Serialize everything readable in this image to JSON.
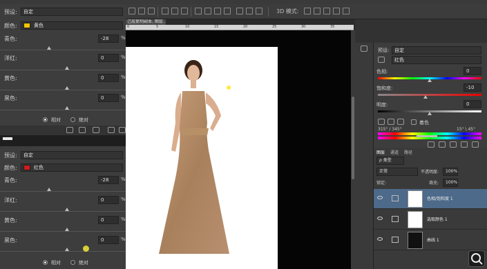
{
  "toolbar": {
    "mode_3d": "3D 模式:"
  },
  "document": {
    "tab_title": "己层复制副本, 图层...",
    "ruler_ticks": [
      "0",
      "5",
      "10",
      "15",
      "20",
      "25",
      "30",
      "35"
    ]
  },
  "dialog_top": {
    "preset_label": "预设:",
    "preset_value": "自定",
    "color_label": "颜色:",
    "color_value": "黄色",
    "color_swatch": "#f2c500",
    "sliders": [
      {
        "label": "青色:",
        "value": "-28",
        "unit": "%"
      },
      {
        "label": "洋红:",
        "value": "0",
        "unit": "%"
      },
      {
        "label": "黄色:",
        "value": "0",
        "unit": "%"
      },
      {
        "label": "黑色:",
        "value": "0",
        "unit": "%"
      }
    ],
    "radio_relative": "相对",
    "radio_absolute": "绝对"
  },
  "dialog_bottom": {
    "preset_label": "预设:",
    "preset_value": "自定",
    "color_label": "颜色:",
    "color_value": "红色",
    "color_swatch": "#d11a1a",
    "sliders": [
      {
        "label": "青色:",
        "value": "-28",
        "unit": "%"
      },
      {
        "label": "洋红:",
        "value": "0",
        "unit": "%"
      },
      {
        "label": "黄色:",
        "value": "0",
        "unit": "%"
      },
      {
        "label": "黑色:",
        "value": "0",
        "unit": "%"
      }
    ],
    "radio_relative": "相对",
    "radio_absolute": "绝对"
  },
  "properties": {
    "preset_label": "预设:",
    "preset_value": "自定",
    "channel_value": "红色",
    "hue_label": "色相:",
    "hue_value": "0",
    "saturation_label": "饱和度:",
    "saturation_value": "-10",
    "lightness_label": "明度:",
    "lightness_value": "0",
    "colorize_label": "着色",
    "range_left": "315° / 345°",
    "range_right": "15° \\ 45°"
  },
  "layers": {
    "tabs": [
      "图层",
      "通道",
      "路径"
    ],
    "filter_label": "ρ 类型",
    "blend_mode": "正常",
    "opacity_label": "不透明度:",
    "opacity_value": "100%",
    "lock_label": "锁定:",
    "fill_label": "填充:",
    "fill_value": "100%",
    "items": [
      {
        "name": "色相/饱和度 1"
      },
      {
        "name": "选取颜色 1"
      },
      {
        "name": "曲线 1"
      }
    ]
  }
}
